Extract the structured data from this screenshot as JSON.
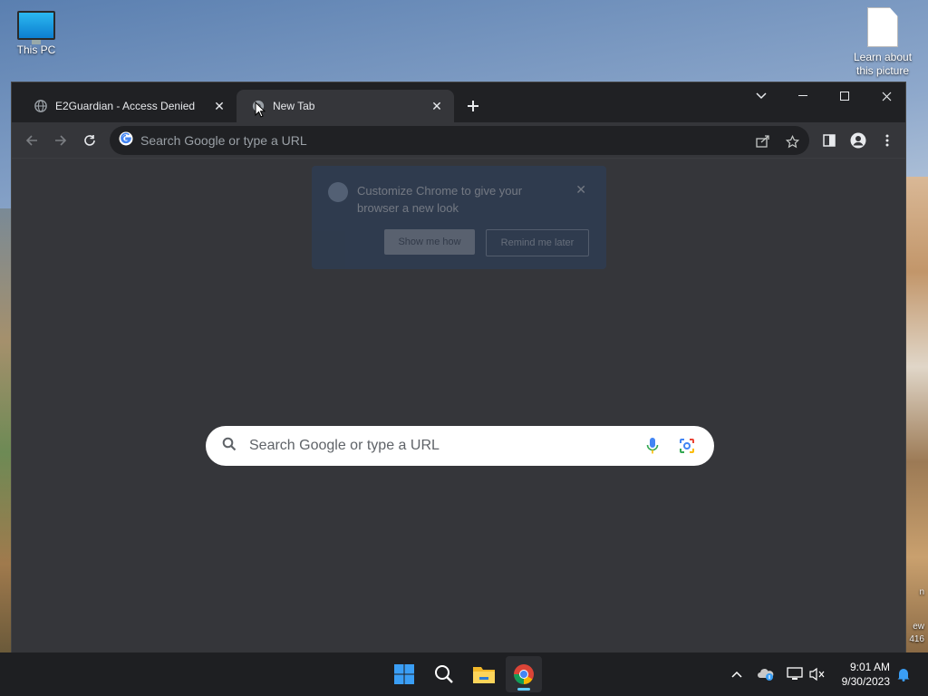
{
  "desktop": {
    "icons": [
      {
        "label": "This PC",
        "icon": "this-pc-icon"
      },
      {
        "label": "Learn about this picture",
        "icon": "document-icon"
      }
    ],
    "edge_text_1": "n",
    "edge_text_2": "ew",
    "edge_text_3": "416"
  },
  "browser": {
    "tabs": [
      {
        "label": "E2Guardian - Access Denied",
        "icon": "globe-icon",
        "active": false
      },
      {
        "label": "New Tab",
        "icon": "chrome-icon",
        "active": true
      }
    ],
    "omnibox": {
      "placeholder": "Search Google or type a URL"
    },
    "promo": {
      "message": "Customize Chrome to give your browser a new look",
      "primary_button": "Show me how",
      "secondary_button": "Remind me later"
    },
    "ntp_search": {
      "placeholder": "Search Google or type a URL"
    }
  },
  "taskbar": {
    "clock": {
      "time": "9:01 AM",
      "date": "9/30/2023"
    },
    "apps": [
      "start-icon",
      "search-icon",
      "file-explorer-icon",
      "chrome-icon"
    ]
  },
  "colors": {
    "tabstrip": "#202124",
    "toolbar": "#35363a",
    "taskbar": "#1e1f22",
    "accent": "#60cdff"
  }
}
